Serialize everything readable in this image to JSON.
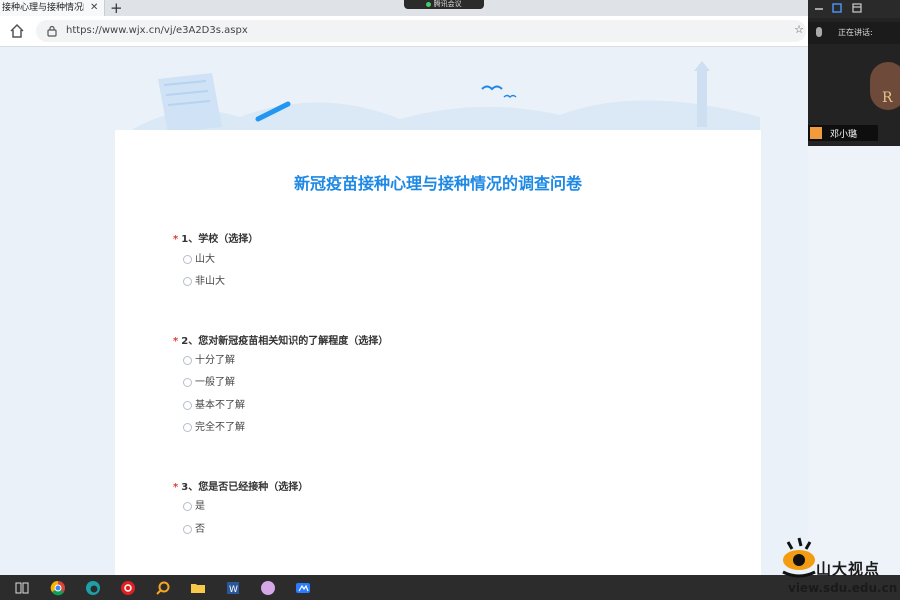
{
  "browser": {
    "tab_title": "接种心理与接种情况的",
    "tab_close": "✕",
    "new_tab": "+",
    "url": "https://www.wjx.cn/vj/e3A2D3s.aspx",
    "favorite": "☆"
  },
  "meeting": {
    "title": "腾讯会议"
  },
  "survey": {
    "title": "新冠疫苗接种心理与接种情况的调查问卷",
    "questions": [
      {
        "required": "*",
        "label": "1、学校（选择）",
        "options": [
          "山大",
          "非山大"
        ]
      },
      {
        "required": "*",
        "label": "2、您对新冠疫苗相关知识的了解程度（选择）",
        "options": [
          "十分了解",
          "一般了解",
          "基本不了解",
          "完全不了解"
        ]
      },
      {
        "required": "*",
        "label": "3、您是否已经接种（选择）",
        "options": [
          "是",
          "否"
        ]
      }
    ]
  },
  "video_panel": {
    "speaking_label": "正在讲话:",
    "participant_name": "邓小璐",
    "avatar_letter": "R"
  },
  "watermark": {
    "line1": "山大视点",
    "line2": "view.sdu.edu.cn"
  },
  "taskbar": {
    "icons": [
      "task-view-icon",
      "chrome-icon",
      "edge-icon",
      "netease-music-icon",
      "search-icon",
      "file-explorer-icon",
      "word-icon",
      "app-icon",
      "tencent-meeting-icon"
    ]
  },
  "colors": {
    "accent": "#1e88e5",
    "required": "#e53935"
  }
}
